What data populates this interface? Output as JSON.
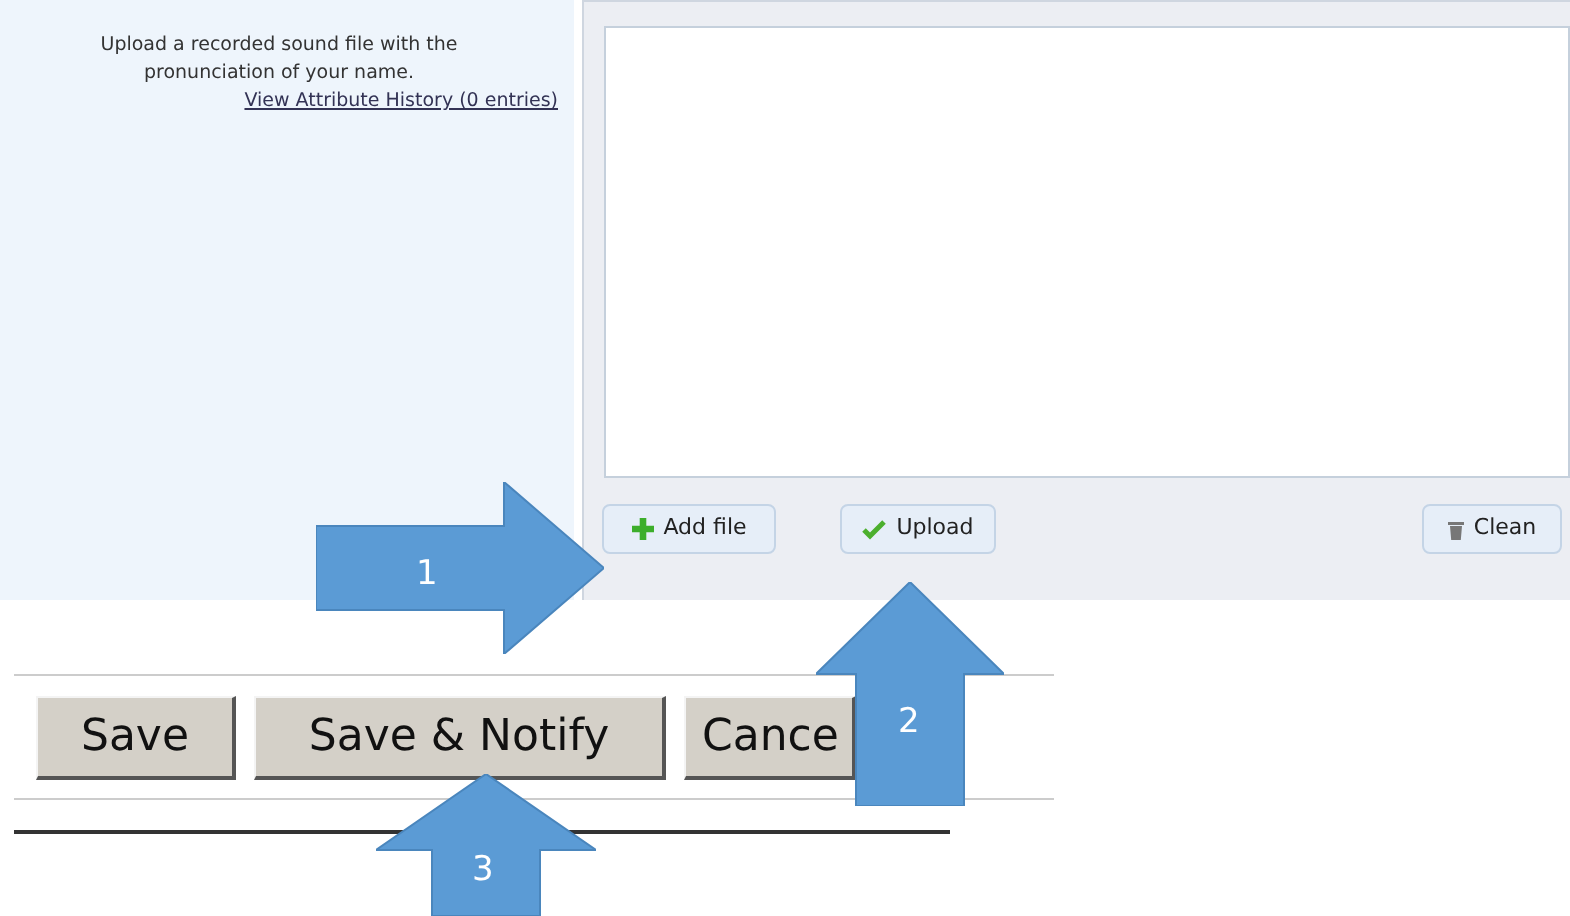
{
  "upload_hint": {
    "description": "Upload a recorded sound file with the pronunciation of your name.",
    "history_link": "View Attribute History (0 entries)"
  },
  "uploader": {
    "buttons": [
      {
        "kind": "add",
        "label": "Add file"
      },
      {
        "kind": "upload",
        "label": "Upload"
      },
      {
        "kind": "clean",
        "label": "Clean"
      }
    ]
  },
  "form_buttons": [
    "Save",
    "Save & Notify",
    "Cance"
  ],
  "callouts": [
    {
      "kind": "right",
      "label": "1"
    },
    {
      "kind": "up",
      "label": "2"
    },
    {
      "kind": "up",
      "label": "3"
    }
  ]
}
